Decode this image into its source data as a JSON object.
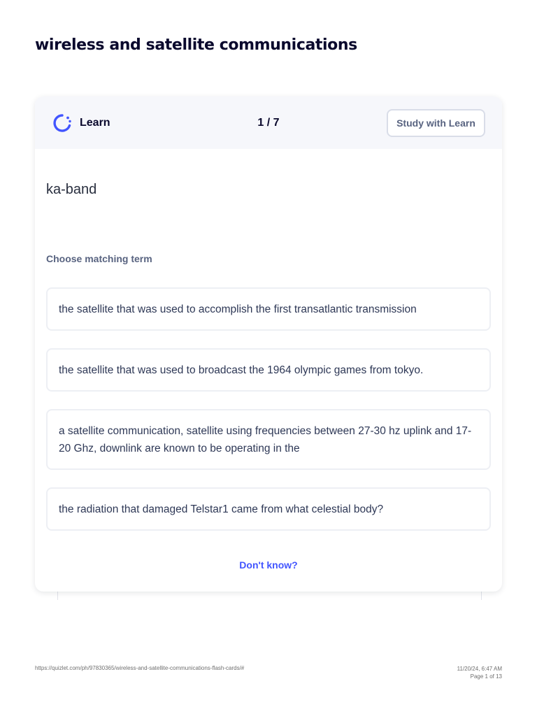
{
  "page": {
    "title": "wireless and satellite communications"
  },
  "card": {
    "header": {
      "mode_label": "Learn",
      "mode_icon": "learn-progress-icon",
      "progress": "1 / 7",
      "study_button_label": "Study with Learn"
    },
    "term": "ka-band",
    "prompt": "Choose matching term",
    "options": [
      "the satellite that was used to accomplish the first transatlantic transmission",
      "the satellite that was used to broadcast the 1964 olympic games from tokyo.",
      "a satellite communication, satellite using frequencies between 27-30 hz uplink and 17-20 Ghz, downlink are known to be operating in the",
      "the radiation that damaged Telstar1 came from what celestial body?"
    ],
    "dont_know_label": "Don't know?"
  },
  "footer": {
    "url": "https://quizlet.com/ph/97830365/wireless-and-satellite-communications-flash-cards/#",
    "timestamp": "11/20/24, 6:47 AM",
    "page_info": "Page 1 of 13"
  },
  "colors": {
    "accent": "#4255ff",
    "header_background": "#f6f7fb",
    "title": "#0a092d",
    "muted_text": "#586380"
  }
}
